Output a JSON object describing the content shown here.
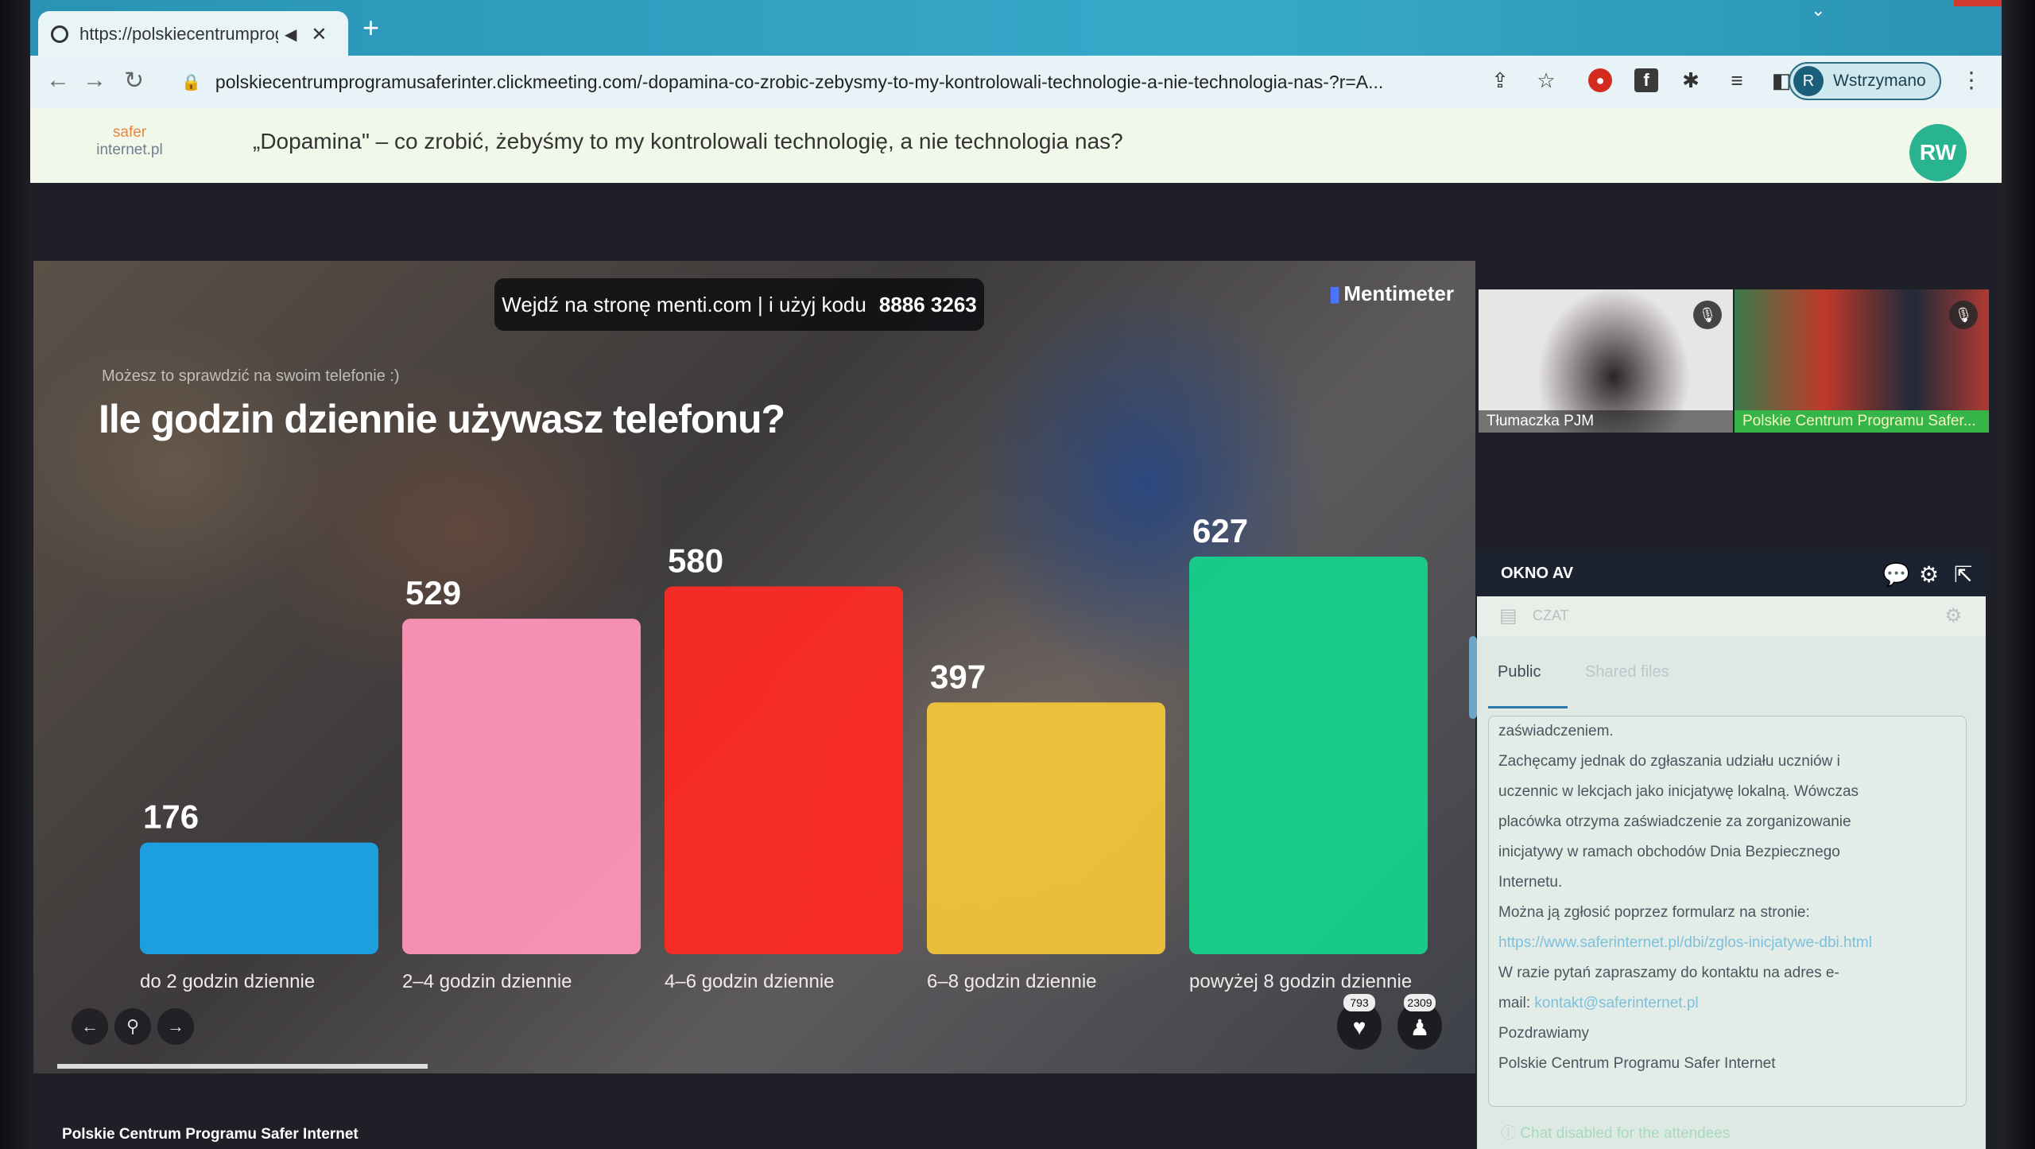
{
  "browser": {
    "tab_title": "https://polskiecentrumprogr",
    "new_tab": "+",
    "url": "polskiecentrumprogramusaferinter.clickmeeting.com/-dopamina-co-zrobic-zebysmy-to-my-kontrolowali-technologie-a-nie-technologia-nas-?r=A...",
    "profile_initial": "R",
    "profile_label": "Wstrzymano"
  },
  "header": {
    "brand_line1": "safer",
    "brand_line2": "internet.pl",
    "event_title": "„Dopamina\" – co zrobić, żebyśmy to my kontrolowali technologię, a nie technologia nas?",
    "user_initials": "RW"
  },
  "presentation": {
    "join_text": "Wejdź na stronę menti.com | i użyj kodu",
    "join_code": "8886 3263",
    "logo": "Mentimeter",
    "subtitle": "Możesz to sprawdzić na swoim telefonie :)",
    "question": "Ile godzin dziennie używasz telefonu?",
    "reactions_count": "793",
    "participants_count": "2309",
    "footer_brand": "Polskie Centrum Programu Safer Internet"
  },
  "chart_data": {
    "type": "bar",
    "title": "Ile godzin dziennie używasz telefonu?",
    "categories": [
      "do 2 godzin dziennie",
      "2–4 godzin dziennie",
      "4–6 godzin dziennie",
      "6–8 godzin dziennie",
      "powyżej 8 godzin dziennie"
    ],
    "values": [
      176,
      529,
      580,
      397,
      627
    ],
    "colors": [
      "#1aa3e8",
      "#ff95b8",
      "#ff2a24",
      "#f0c43a",
      "#16d18c"
    ]
  },
  "videos": [
    {
      "name": "Tłumaczka PJM"
    },
    {
      "name": "Polskie Centrum Programu Safer..."
    }
  ],
  "av_window": {
    "title": "OKNO AV"
  },
  "chat": {
    "header": "CZAT",
    "tabs": [
      "Public",
      "Shared files"
    ],
    "lines": [
      "zaświadczeniem.",
      "Zachęcamy jednak do zgłaszania udziału uczniów i",
      "uczennic w lekcjach jako inicjatywę lokalną. Wówczas",
      "placówka otrzyma zaświadczenie za zorganizowanie",
      "inicjatywy w ramach obchodów Dnia Bezpiecznego",
      "Internetu.",
      "Można ją zgłosić poprzez formularz na stronie:",
      "https://www.saferinternet.pl/dbi/zglos-inicjatywe-dbi.html",
      "W razie pytań zapraszamy do kontaktu na adres e-",
      "mail:",
      "Pozdrawiamy",
      "Polskie Centrum Programu Safer Internet"
    ],
    "email": "kontakt@saferinternet.pl",
    "disabled_text": "Chat disabled for the attendees"
  }
}
